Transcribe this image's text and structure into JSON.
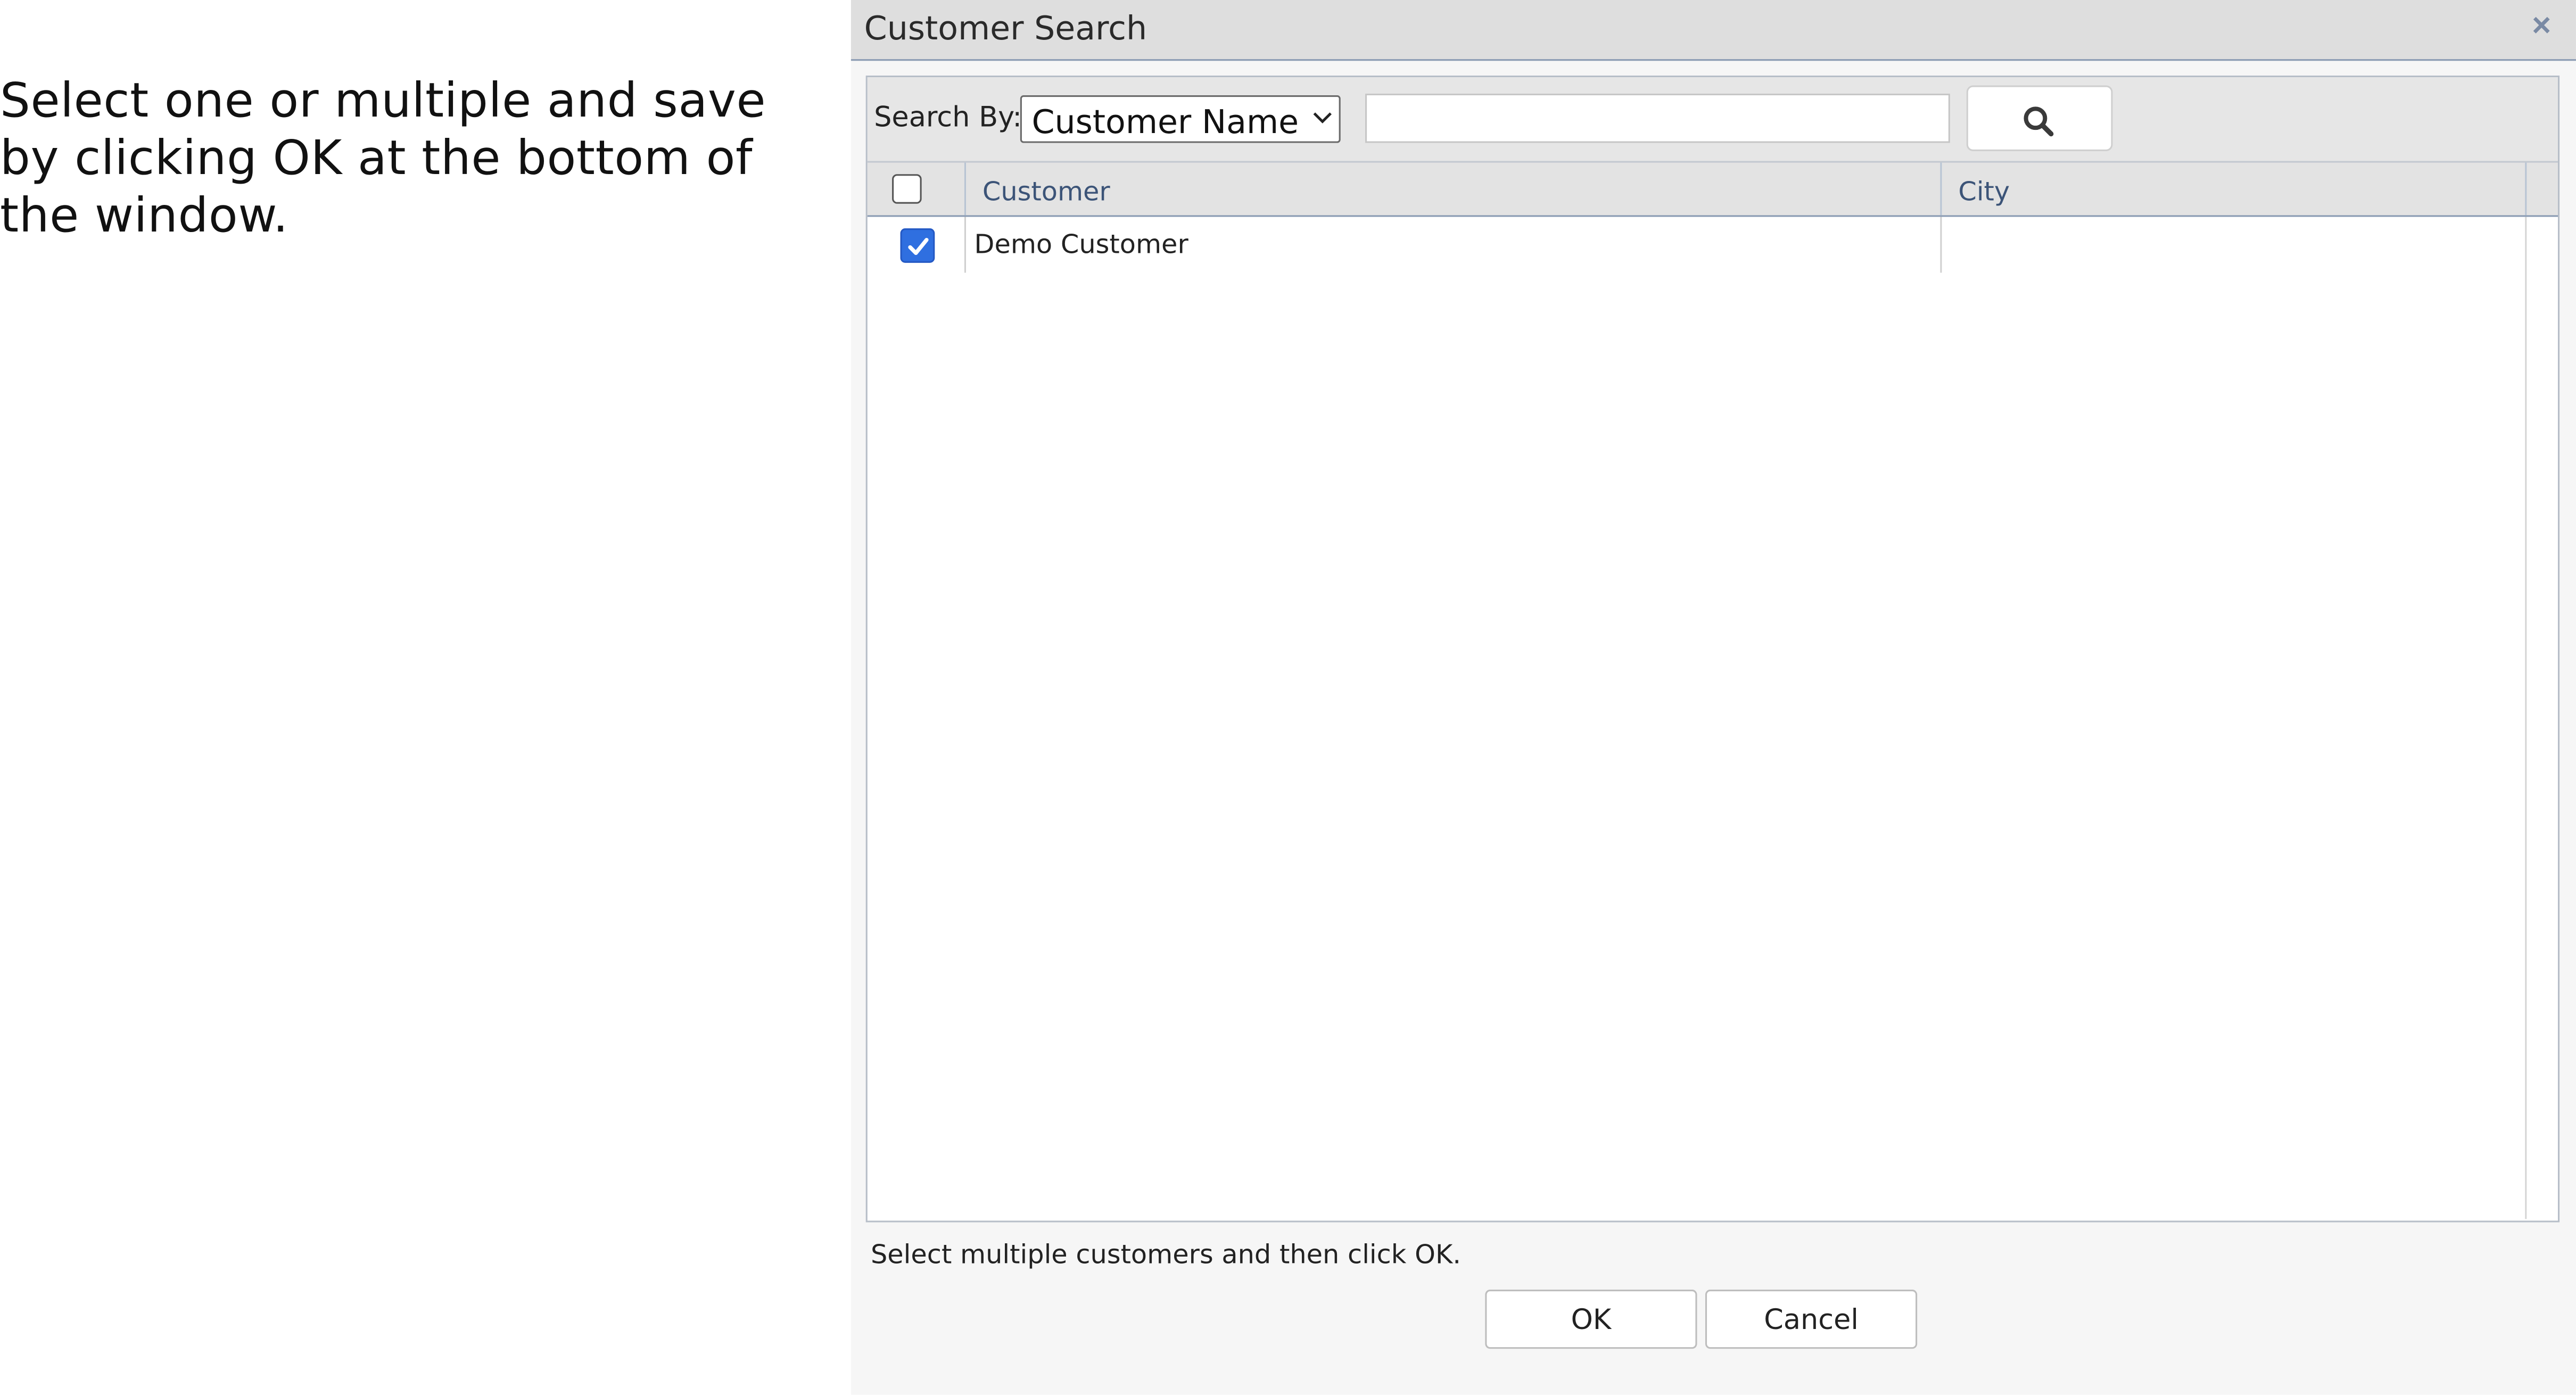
{
  "instruction": {
    "text": "Select one or multiple and save by clicking OK at the bottom of the window."
  },
  "dialog": {
    "title": "Customer Search",
    "close_icon": "close-icon",
    "search_by_label": "Search By:",
    "search_by_selected": "Customer Name",
    "search_input": {
      "value": "",
      "placeholder": ""
    },
    "search_button_icon": "search-icon",
    "grid": {
      "select_all_checked": false,
      "columns": [
        "Customer",
        "City"
      ],
      "rows": [
        {
          "checked": true,
          "customer": "Demo Customer",
          "city": ""
        }
      ]
    },
    "hint": "Select multiple customers and then click OK.",
    "ok_label": "OK",
    "cancel_label": "Cancel"
  },
  "colors": {
    "accent": "#2f6fe0",
    "header_text": "#3c5478",
    "titlebar_bg": "#dedede"
  }
}
